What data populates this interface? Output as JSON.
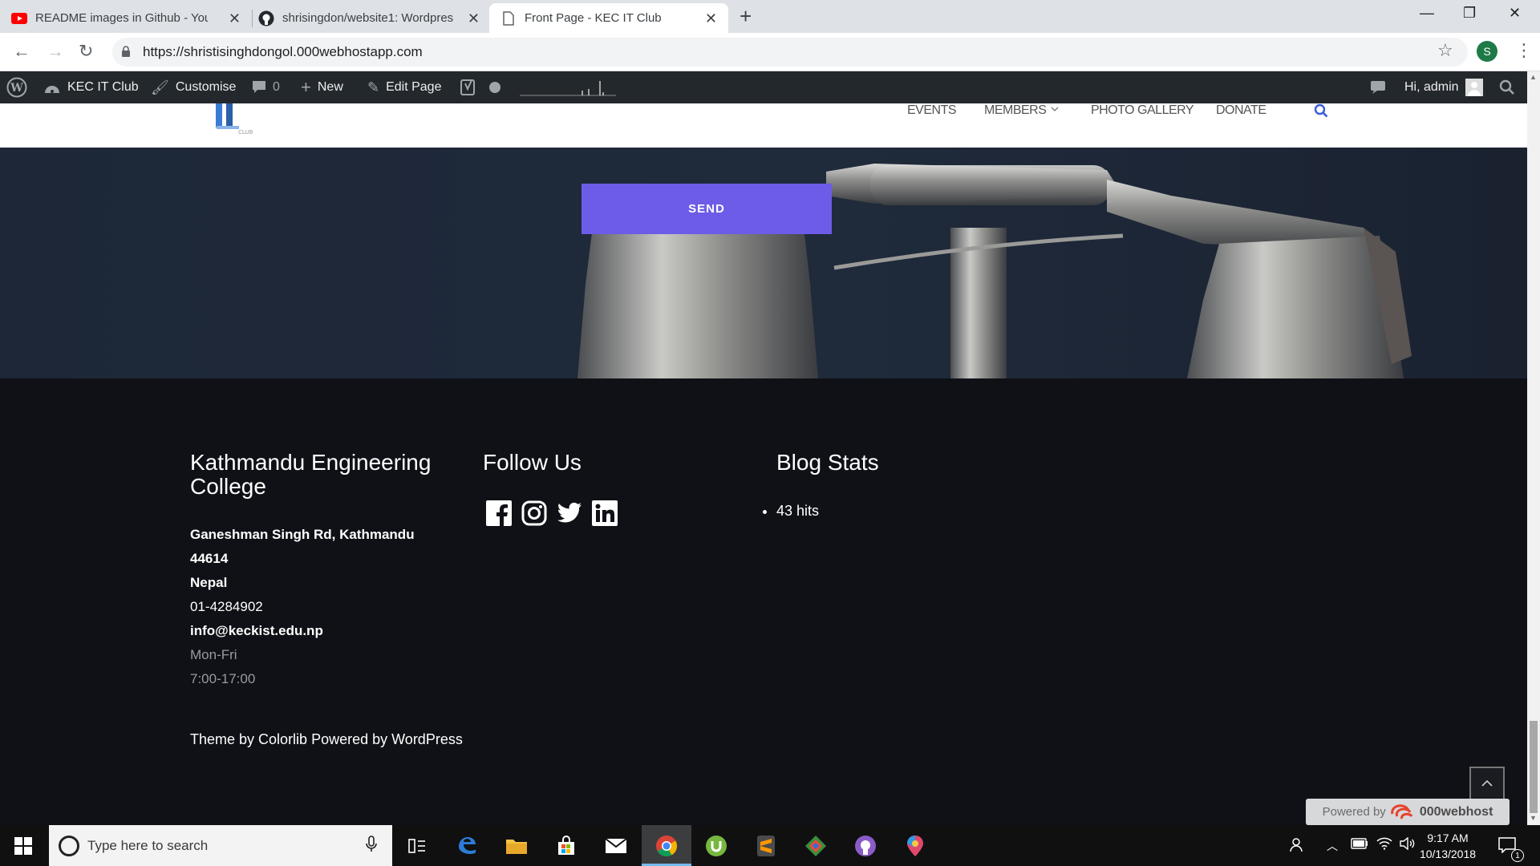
{
  "browser": {
    "tabs": [
      {
        "label": "README images in Github - You",
        "icon": "youtube-icon",
        "active": false
      },
      {
        "label": "shrisingdon/website1: Wordpres",
        "icon": "github-icon",
        "active": false
      },
      {
        "label": "Front Page - KEC IT Club",
        "icon": "page-icon",
        "active": true
      }
    ],
    "url": "https://shristisinghdongol.000webhostapp.com",
    "profile_initial": "S"
  },
  "adminbar": {
    "site_name": "KEC IT Club",
    "customise": "Customise",
    "comments_count": "0",
    "new_label": "New",
    "edit_page": "Edit Page",
    "greeting": "Hi, admin"
  },
  "header": {
    "nav": [
      "EVENTS",
      "MEMBERS",
      "PHOTO GALLERY",
      "DONATE"
    ]
  },
  "hero": {
    "send_label": "SEND"
  },
  "footer": {
    "col1_title": "Kathmandu Engineering College",
    "address_line1": "Ganeshman Singh Rd, Kathmandu",
    "address_line2": "44614",
    "country": "Nepal",
    "phone": "01-4284902",
    "email": "info@keckist.edu.np",
    "days": "Mon-Fri",
    "hours": "7:00-17:00",
    "col2_title": "Follow Us",
    "social": [
      "facebook-icon",
      "instagram-icon",
      "twitter-icon",
      "linkedin-icon"
    ],
    "col3_title": "Blog Stats",
    "hits": "43 hits",
    "credit_prefix": "Theme by ",
    "credit_colorlib": "Colorlib",
    "credit_mid": " Powered by ",
    "credit_wp": "WordPress",
    "powered_by": "Powered by",
    "host_brand": "000webhost"
  },
  "taskbar": {
    "search_placeholder": "Type here to search",
    "time": "9:17 AM",
    "date": "10/13/2018",
    "notification_count": "1"
  },
  "colors": {
    "send_button": "#6c5ce7",
    "footer_bg": "#0f1116",
    "adminbar_bg": "#23282d",
    "nav_search": "#3b5bdb"
  }
}
